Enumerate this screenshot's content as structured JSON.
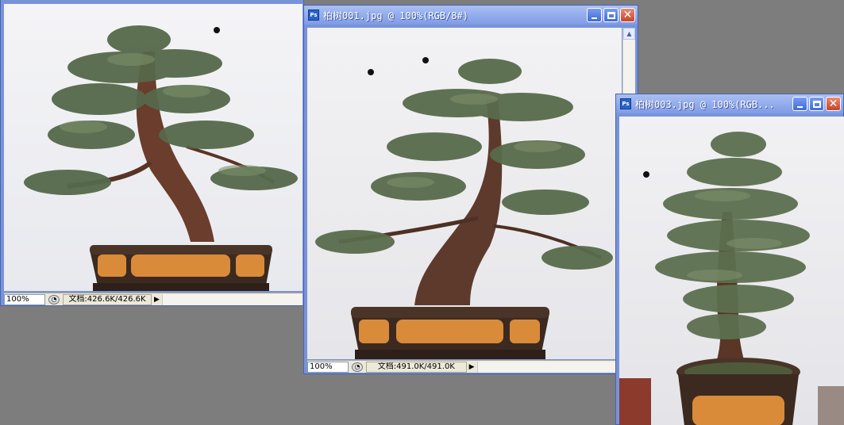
{
  "windows": [
    {
      "id": "win1",
      "zoom": "100%",
      "doc_info": "文档:426.6K/426.6K",
      "ps_icon": "Ps",
      "nav_icon": "navigator-icon"
    },
    {
      "id": "win2",
      "title": "柏树001.jpg @ 100%(RGB/8#)",
      "zoom": "100%",
      "doc_info": "文档:491.0K/491.0K",
      "ps_icon": "Ps",
      "nav_icon": "navigator-icon"
    },
    {
      "id": "win3",
      "title": "柏树003.jpg @ 100%(RGB...",
      "ps_icon": "Ps"
    }
  ],
  "status_arrow": "▶",
  "scroll_up": "▲",
  "colors": {
    "workspace": "#7d7d7d",
    "window_frame": "#7893d8",
    "titlebar_top": "#a9bff3",
    "titlebar_bottom": "#7f9be6",
    "pot": "#3c2a20",
    "pot_panel": "#d98b3a",
    "foliage": "#5b6e4e",
    "trunk": "#5a3425"
  }
}
